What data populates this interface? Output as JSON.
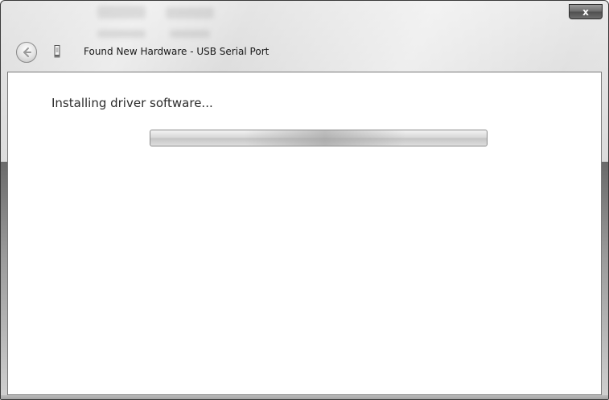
{
  "window": {
    "title": "Found New Hardware - USB Serial Port",
    "close_label": "x",
    "accent_color": "#6b6b6b"
  },
  "icons": {
    "back": "back-arrow-icon",
    "device": "usb-device-icon",
    "close": "close-icon"
  },
  "content": {
    "status": "Installing driver software...",
    "progress": {
      "mode": "indeterminate",
      "glow_position_fraction": 0.52
    }
  }
}
